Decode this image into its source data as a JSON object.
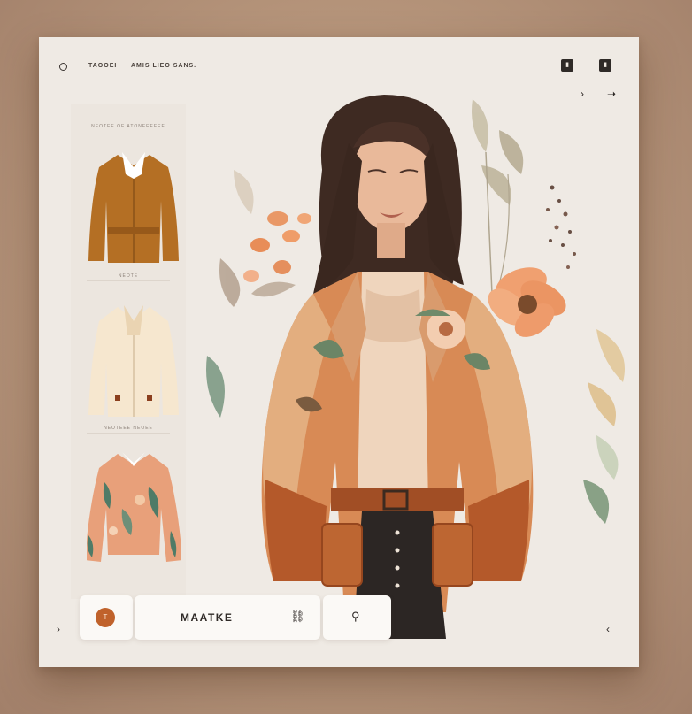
{
  "topbar": {
    "label_left": "TAOOEI",
    "label_right": "AMIS LIEO SANS.",
    "square_button_1": "▮",
    "square_button_2": "▮",
    "prev_arrow": "›",
    "next_arrow": "›"
  },
  "sidebar": {
    "section_1_label": "NEOTEE OE ATONEEEEEE",
    "section_2_label": "NEOTE",
    "section_3_label": "NEOTEEE  NEOEE",
    "products": [
      {
        "name": "mustard-blazer"
      },
      {
        "name": "cream-jacket"
      },
      {
        "name": "floral-blouse"
      }
    ]
  },
  "bottombar": {
    "circle_button_label": "T",
    "title": "MAATKE",
    "link_icon": "link-icon",
    "share_icon": "share-icon"
  },
  "nav": {
    "left_arrow": "›",
    "right_arrow": "‹"
  },
  "colors": {
    "background": "#b5947a",
    "card": "#efeae4",
    "accent_orange": "#c0622b",
    "dark": "#2f2a27"
  }
}
